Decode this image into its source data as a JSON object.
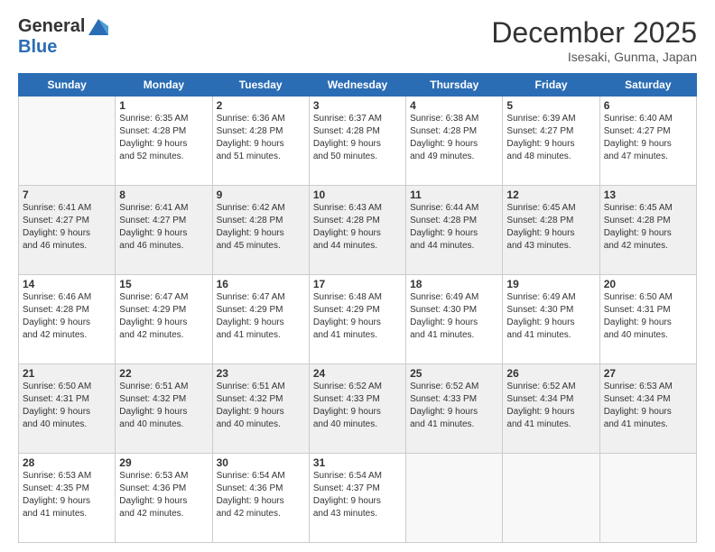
{
  "header": {
    "logo_general": "General",
    "logo_blue": "Blue",
    "month_title": "December 2025",
    "location": "Isesaki, Gunma, Japan"
  },
  "weekdays": [
    "Sunday",
    "Monday",
    "Tuesday",
    "Wednesday",
    "Thursday",
    "Friday",
    "Saturday"
  ],
  "weeks": [
    [
      {
        "day": "",
        "info": ""
      },
      {
        "day": "1",
        "info": "Sunrise: 6:35 AM\nSunset: 4:28 PM\nDaylight: 9 hours\nand 52 minutes."
      },
      {
        "day": "2",
        "info": "Sunrise: 6:36 AM\nSunset: 4:28 PM\nDaylight: 9 hours\nand 51 minutes."
      },
      {
        "day": "3",
        "info": "Sunrise: 6:37 AM\nSunset: 4:28 PM\nDaylight: 9 hours\nand 50 minutes."
      },
      {
        "day": "4",
        "info": "Sunrise: 6:38 AM\nSunset: 4:28 PM\nDaylight: 9 hours\nand 49 minutes."
      },
      {
        "day": "5",
        "info": "Sunrise: 6:39 AM\nSunset: 4:27 PM\nDaylight: 9 hours\nand 48 minutes."
      },
      {
        "day": "6",
        "info": "Sunrise: 6:40 AM\nSunset: 4:27 PM\nDaylight: 9 hours\nand 47 minutes."
      }
    ],
    [
      {
        "day": "7",
        "info": "Sunrise: 6:41 AM\nSunset: 4:27 PM\nDaylight: 9 hours\nand 46 minutes."
      },
      {
        "day": "8",
        "info": "Sunrise: 6:41 AM\nSunset: 4:27 PM\nDaylight: 9 hours\nand 46 minutes."
      },
      {
        "day": "9",
        "info": "Sunrise: 6:42 AM\nSunset: 4:28 PM\nDaylight: 9 hours\nand 45 minutes."
      },
      {
        "day": "10",
        "info": "Sunrise: 6:43 AM\nSunset: 4:28 PM\nDaylight: 9 hours\nand 44 minutes."
      },
      {
        "day": "11",
        "info": "Sunrise: 6:44 AM\nSunset: 4:28 PM\nDaylight: 9 hours\nand 44 minutes."
      },
      {
        "day": "12",
        "info": "Sunrise: 6:45 AM\nSunset: 4:28 PM\nDaylight: 9 hours\nand 43 minutes."
      },
      {
        "day": "13",
        "info": "Sunrise: 6:45 AM\nSunset: 4:28 PM\nDaylight: 9 hours\nand 42 minutes."
      }
    ],
    [
      {
        "day": "14",
        "info": "Sunrise: 6:46 AM\nSunset: 4:28 PM\nDaylight: 9 hours\nand 42 minutes."
      },
      {
        "day": "15",
        "info": "Sunrise: 6:47 AM\nSunset: 4:29 PM\nDaylight: 9 hours\nand 42 minutes."
      },
      {
        "day": "16",
        "info": "Sunrise: 6:47 AM\nSunset: 4:29 PM\nDaylight: 9 hours\nand 41 minutes."
      },
      {
        "day": "17",
        "info": "Sunrise: 6:48 AM\nSunset: 4:29 PM\nDaylight: 9 hours\nand 41 minutes."
      },
      {
        "day": "18",
        "info": "Sunrise: 6:49 AM\nSunset: 4:30 PM\nDaylight: 9 hours\nand 41 minutes."
      },
      {
        "day": "19",
        "info": "Sunrise: 6:49 AM\nSunset: 4:30 PM\nDaylight: 9 hours\nand 41 minutes."
      },
      {
        "day": "20",
        "info": "Sunrise: 6:50 AM\nSunset: 4:31 PM\nDaylight: 9 hours\nand 40 minutes."
      }
    ],
    [
      {
        "day": "21",
        "info": "Sunrise: 6:50 AM\nSunset: 4:31 PM\nDaylight: 9 hours\nand 40 minutes."
      },
      {
        "day": "22",
        "info": "Sunrise: 6:51 AM\nSunset: 4:32 PM\nDaylight: 9 hours\nand 40 minutes."
      },
      {
        "day": "23",
        "info": "Sunrise: 6:51 AM\nSunset: 4:32 PM\nDaylight: 9 hours\nand 40 minutes."
      },
      {
        "day": "24",
        "info": "Sunrise: 6:52 AM\nSunset: 4:33 PM\nDaylight: 9 hours\nand 40 minutes."
      },
      {
        "day": "25",
        "info": "Sunrise: 6:52 AM\nSunset: 4:33 PM\nDaylight: 9 hours\nand 41 minutes."
      },
      {
        "day": "26",
        "info": "Sunrise: 6:52 AM\nSunset: 4:34 PM\nDaylight: 9 hours\nand 41 minutes."
      },
      {
        "day": "27",
        "info": "Sunrise: 6:53 AM\nSunset: 4:34 PM\nDaylight: 9 hours\nand 41 minutes."
      }
    ],
    [
      {
        "day": "28",
        "info": "Sunrise: 6:53 AM\nSunset: 4:35 PM\nDaylight: 9 hours\nand 41 minutes."
      },
      {
        "day": "29",
        "info": "Sunrise: 6:53 AM\nSunset: 4:36 PM\nDaylight: 9 hours\nand 42 minutes."
      },
      {
        "day": "30",
        "info": "Sunrise: 6:54 AM\nSunset: 4:36 PM\nDaylight: 9 hours\nand 42 minutes."
      },
      {
        "day": "31",
        "info": "Sunrise: 6:54 AM\nSunset: 4:37 PM\nDaylight: 9 hours\nand 43 minutes."
      },
      {
        "day": "",
        "info": ""
      },
      {
        "day": "",
        "info": ""
      },
      {
        "day": "",
        "info": ""
      }
    ]
  ]
}
